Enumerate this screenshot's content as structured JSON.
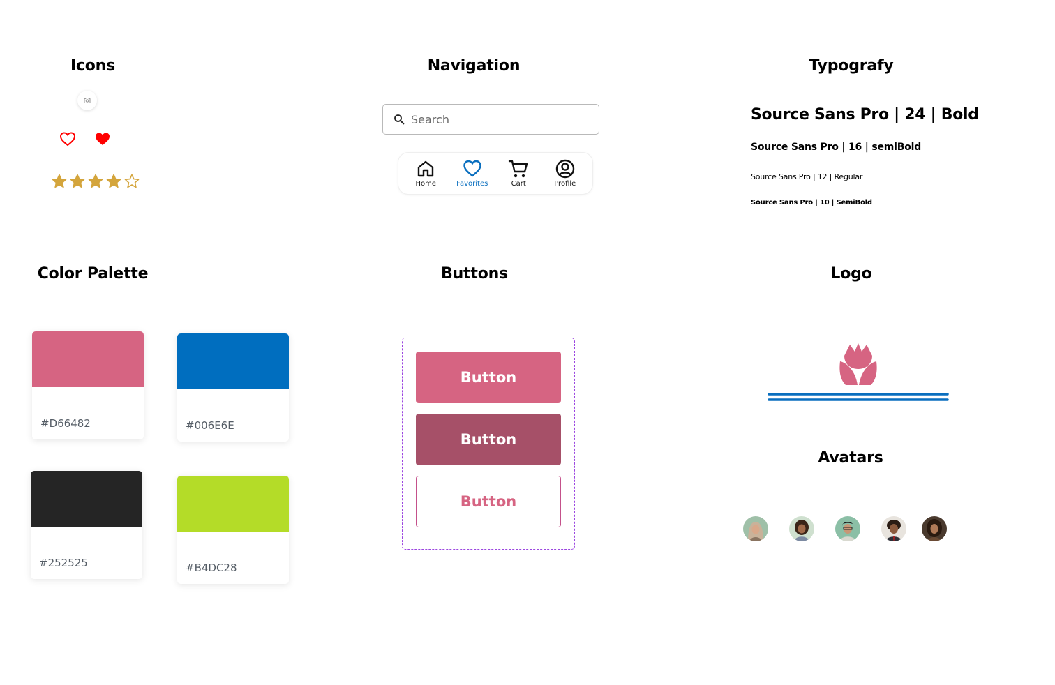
{
  "sections": {
    "icons": "Icons",
    "navigation": "Navigation",
    "typography": "Typografy",
    "color_palette": "Color Palette",
    "buttons": "Buttons",
    "logo": "Logo",
    "avatars": "Avatars"
  },
  "icons": {
    "camera": "camera-icon",
    "heart_outline": "heart-outline-icon",
    "heart_filled": "heart-filled-icon",
    "rating": 4,
    "rating_max": 5,
    "heart_color": "#FF0000",
    "star_color": "#D4A53C"
  },
  "navigation": {
    "search_placeholder": "Search",
    "items": [
      {
        "label": "Home",
        "icon": "home-icon"
      },
      {
        "label": "Favorites",
        "icon": "heart-icon"
      },
      {
        "label": "Cart",
        "icon": "cart-icon"
      },
      {
        "label": "Profile",
        "icon": "profile-icon"
      }
    ],
    "active": "Favorites",
    "active_color": "#0A6FBF"
  },
  "typography": {
    "t24": "Source Sans Pro | 24 | Bold",
    "t16": "Source Sans Pro | 16 | semiBold",
    "t12": "Source Sans Pro | 12 | Regular",
    "t10": "Source Sans Pro | 10 | SemiBold"
  },
  "palette": [
    {
      "hex": "#D66482",
      "label": "#D66482"
    },
    {
      "hex": "#006EBF",
      "label": "#006E6E"
    },
    {
      "hex": "#252525",
      "label": "#252525"
    },
    {
      "hex": "#B4DC28",
      "label": "#B4DC28"
    }
  ],
  "buttons": {
    "primary": "Button",
    "dark": "Button",
    "outline": "Button"
  },
  "logo": {
    "flower_color": "#D66482",
    "line_color": "#0A6FBF"
  },
  "avatars": [
    {
      "name": "avatar-1"
    },
    {
      "name": "avatar-2"
    },
    {
      "name": "avatar-3"
    },
    {
      "name": "avatar-4"
    },
    {
      "name": "avatar-5"
    }
  ]
}
